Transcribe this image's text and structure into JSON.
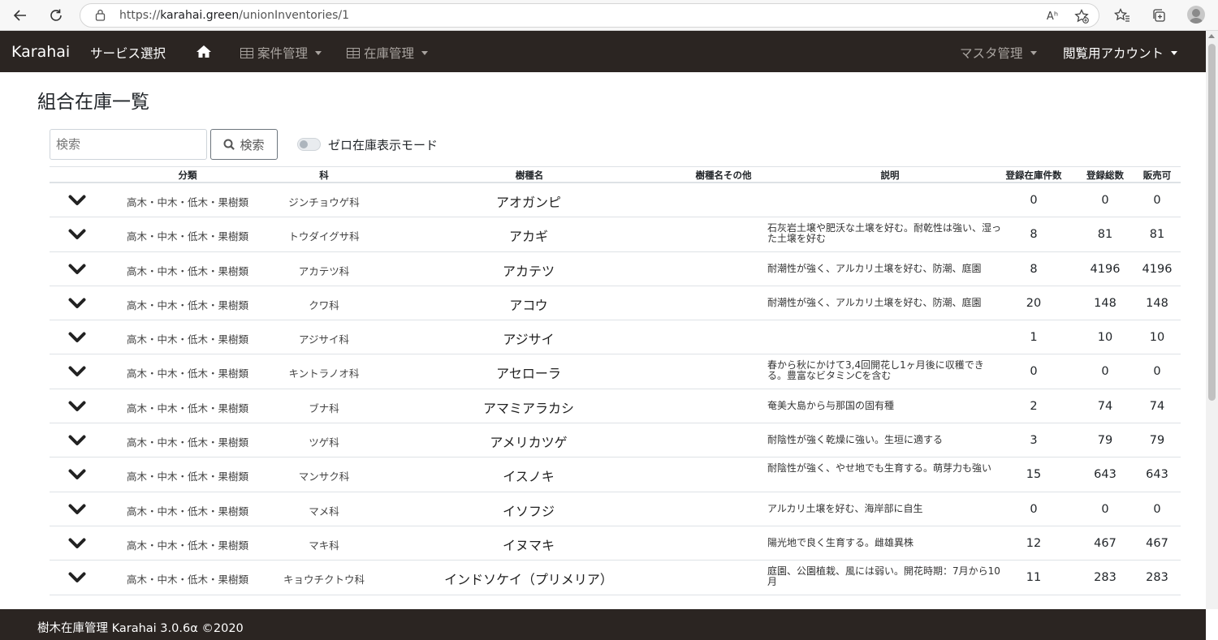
{
  "browser": {
    "url_prefix": "https://",
    "url_domain": "karahai.green",
    "url_path": "/unionInventories/1",
    "reader_label": "Aʰ"
  },
  "navbar": {
    "brand": "Karahai",
    "service_select": "サービス選択",
    "case_management": "案件管理",
    "inventory_management": "在庫管理",
    "master_management": "マスタ管理",
    "account": "閲覧用アカウント"
  },
  "page": {
    "title": "組合在庫一覧",
    "search_placeholder": "検索",
    "search_button": "検索",
    "zero_mode_label": "ゼロ在庫表示モード"
  },
  "table": {
    "headers": {
      "classification": "分類",
      "family": "科",
      "species": "樹種名",
      "species_other": "樹種名その他",
      "description": "説明",
      "registered_items": "登録在庫件数",
      "registered_total": "登録総数",
      "sellable": "販売可"
    },
    "rows": [
      {
        "classification": "高木・中木・低木・果樹類",
        "family": "ジンチョウゲ科",
        "species": "アオガンピ",
        "description": "",
        "count": "0",
        "total": "0",
        "sale": "0"
      },
      {
        "classification": "高木・中木・低木・果樹類",
        "family": "トウダイグサ科",
        "species": "アカギ",
        "description": "石灰岩土壌や肥沃な土壌を好む。耐乾性は強い、湿った土壌を好む",
        "count": "8",
        "total": "81",
        "sale": "81"
      },
      {
        "classification": "高木・中木・低木・果樹類",
        "family": "アカテツ科",
        "species": "アカテツ",
        "description": "耐潮性が強く、アルカリ土壌を好む、防潮、庭園",
        "count": "8",
        "total": "4196",
        "sale": "4196"
      },
      {
        "classification": "高木・中木・低木・果樹類",
        "family": "クワ科",
        "species": "アコウ",
        "description": "耐潮性が強く、アルカリ土壌を好む、防潮、庭園",
        "count": "20",
        "total": "148",
        "sale": "148"
      },
      {
        "classification": "高木・中木・低木・果樹類",
        "family": "アジサイ科",
        "species": "アジサイ",
        "description": "",
        "count": "1",
        "total": "10",
        "sale": "10"
      },
      {
        "classification": "高木・中木・低木・果樹類",
        "family": "キントラノオ科",
        "species": "アセローラ",
        "description": "春から秋にかけて3,4回開花し1ヶ月後に収穫できる。豊富なビタミンCを含む",
        "count": "0",
        "total": "0",
        "sale": "0"
      },
      {
        "classification": "高木・中木・低木・果樹類",
        "family": "ブナ科",
        "species": "アマミアラカシ",
        "description": "奄美大島から与那国の固有種",
        "count": "2",
        "total": "74",
        "sale": "74"
      },
      {
        "classification": "高木・中木・低木・果樹類",
        "family": "ツゲ科",
        "species": "アメリカツゲ",
        "description": "耐陰性が強く乾燥に強い。生垣に適する",
        "count": "3",
        "total": "79",
        "sale": "79"
      },
      {
        "classification": "高木・中木・低木・果樹類",
        "family": "マンサク科",
        "species": "イスノキ",
        "description": "耐陰性が強く、やせ地でも生育する。萌芽力も強い",
        "count": "15",
        "total": "643",
        "sale": "643"
      },
      {
        "classification": "高木・中木・低木・果樹類",
        "family": "マメ科",
        "species": "イソフジ",
        "description": "アルカリ土壌を好む、海岸部に自生",
        "count": "0",
        "total": "0",
        "sale": "0"
      },
      {
        "classification": "高木・中木・低木・果樹類",
        "family": "マキ科",
        "species": "イヌマキ",
        "description": "陽光地で良く生育する。雌雄異株",
        "count": "12",
        "total": "467",
        "sale": "467"
      },
      {
        "classification": "高木・中木・低木・果樹類",
        "family": "キョウチクトウ科",
        "species": "インドソケイ（プリメリア）",
        "description": "庭園、公園植栽、風には弱い。開花時期：7月から10月",
        "count": "11",
        "total": "283",
        "sale": "283"
      }
    ]
  },
  "footer": {
    "text": "樹木在庫管理 Karahai 3.0.6α ©2020"
  },
  "colors": {
    "navbar_bg": "#2b2522",
    "muted_nav": "#a8a39f"
  }
}
